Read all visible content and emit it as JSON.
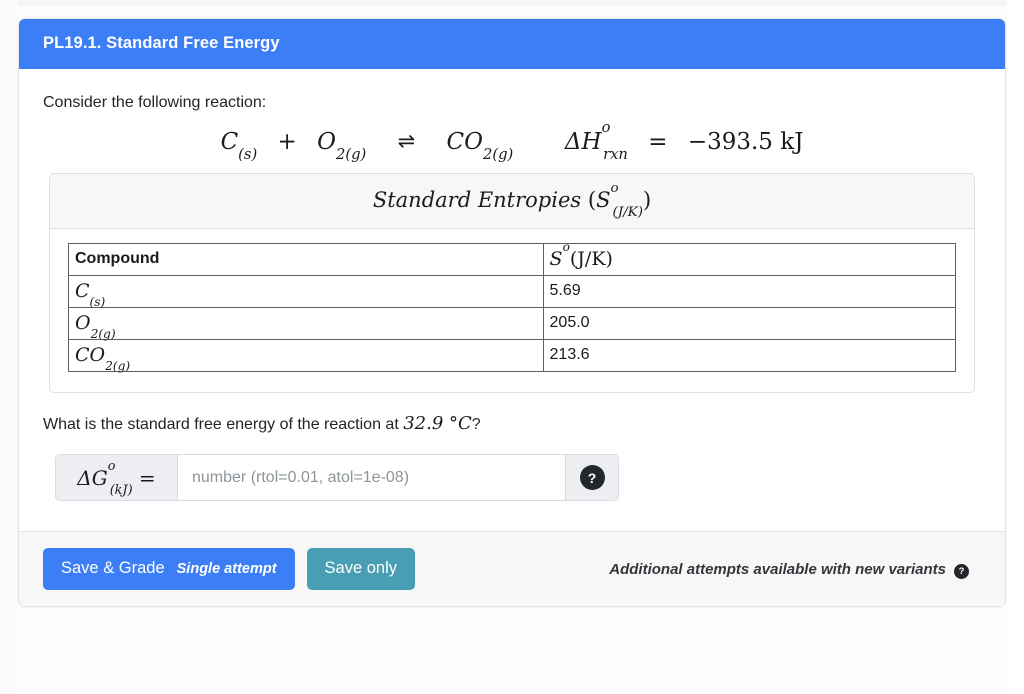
{
  "header": {
    "title": "PL19.1. Standard Free Energy"
  },
  "body": {
    "intro": "Consider the following reaction:",
    "equation": {
      "reactant1": "C",
      "reactant1_state": "(s)",
      "plus": "+",
      "reactant2": "O",
      "reactant2_sub": "2",
      "reactant2_state": "(g)",
      "arrow": "⇌",
      "product": "CO",
      "product_sub": "2",
      "product_state": "(g)",
      "enthalpy_symbol": "ΔH",
      "enthalpy_sup": "o",
      "enthalpy_sub": "rxn",
      "enthalpy_equals": "=",
      "enthalpy_value": "−393.5 kJ"
    }
  },
  "table_panel": {
    "title_main": "Standard Entropies",
    "title_open_paren": "(",
    "title_symbol": "S",
    "title_sup": "o",
    "title_sub": "(J/K)",
    "title_close_paren": ")"
  },
  "chart_data": {
    "type": "table",
    "title": "Standard Entropies (S°(J/K))",
    "columns": [
      "Compound",
      "Sᵒ(J/K)"
    ],
    "rows": [
      {
        "compound": "C(s)",
        "value": "5.69"
      },
      {
        "compound": "O2(g)",
        "value": "205.0"
      },
      {
        "compound": "CO2(g)",
        "value": "213.6"
      }
    ],
    "column_headers": {
      "compound": "Compound",
      "value_symbol": "S",
      "value_sup": "o",
      "value_units": "(J/K)"
    },
    "cells": [
      {
        "formula": "C",
        "sub": "",
        "state": "(s)",
        "value": "5.69"
      },
      {
        "formula": "O",
        "sub": "2",
        "state": "(g)",
        "value": "205.0"
      },
      {
        "formula": "CO",
        "sub": "2",
        "state": "(g)",
        "value": "213.6"
      }
    ]
  },
  "question": {
    "text_before": "What is the standard free energy of the reaction at ",
    "temperature": "32.9",
    "degree": "°",
    "unit": "C",
    "text_after": "?"
  },
  "answer_input": {
    "label_symbol": "ΔG",
    "label_sup": "o",
    "label_sub": "(kJ)",
    "label_equals": "=",
    "value": "",
    "placeholder": "number (rtol=0.01, atol=1e-08)",
    "help_icon": "?",
    "help_icon_name": "question-mark-icon"
  },
  "footer": {
    "save_grade_label": "Save & Grade",
    "save_grade_sub": "Single attempt",
    "save_only_label": "Save only",
    "note": "Additional attempts available with new variants",
    "note_help_icon": "?"
  },
  "colors": {
    "header_blue": "#3b7ef5",
    "save_teal": "#4a9eb4",
    "panel_grey": "#f7f7f7",
    "help_dark": "#23272b"
  }
}
